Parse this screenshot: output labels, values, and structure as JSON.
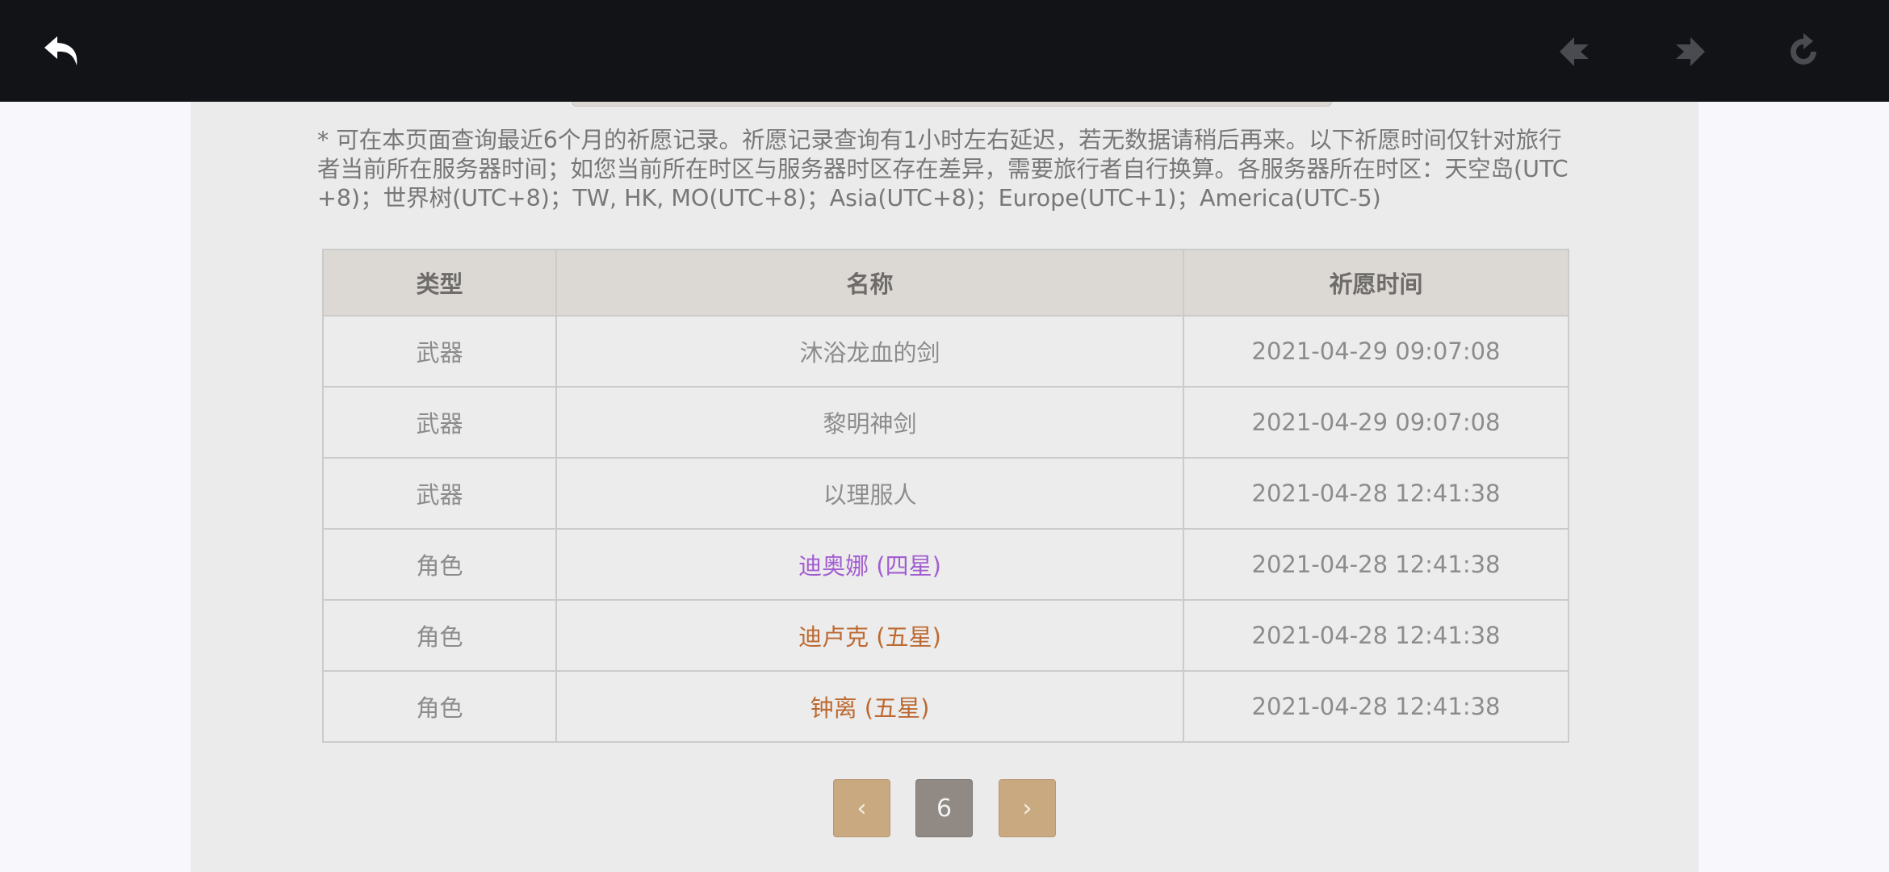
{
  "toolbar": {
    "back_icon": "back-arrow-icon",
    "prev_icon": "prev-diamond-arrow-icon",
    "next_icon": "next-diamond-arrow-icon",
    "reload_icon": "reload-icon",
    "background": "#121317"
  },
  "notice": "* 可在本页面查询最近6个月的祈愿记录。祈愿记录查询有1小时左右延迟，若无数据请稍后再来。以下祈愿时间仅针对旅行者当前所在服务器时间；如您当前所在时区与服务器时区存在差异，需要旅行者自行换算。各服务器所在时区：天空岛(UTC+8)；世界树(UTC+8)；TW, HK, MO(UTC+8)；Asia(UTC+8)；Europe(UTC+1)；America(UTC-5)",
  "table": {
    "headers": [
      "类型",
      "名称",
      "祈愿时间"
    ],
    "rows": [
      {
        "type": "武器",
        "name": "沐浴龙血的剑",
        "time": "2021-04-29 09:07:08",
        "rarity": "3"
      },
      {
        "type": "武器",
        "name": "黎明神剑",
        "time": "2021-04-29 09:07:08",
        "rarity": "3"
      },
      {
        "type": "武器",
        "name": "以理服人",
        "time": "2021-04-28 12:41:38",
        "rarity": "3"
      },
      {
        "type": "角色",
        "name": "迪奥娜 (四星)",
        "time": "2021-04-28 12:41:38",
        "rarity": "4"
      },
      {
        "type": "角色",
        "name": "迪卢克 (五星)",
        "time": "2021-04-28 12:41:38",
        "rarity": "5"
      },
      {
        "type": "角色",
        "name": "钟离 (五星)",
        "time": "2021-04-28 12:41:38",
        "rarity": "5"
      }
    ]
  },
  "colors": {
    "rarity_3": "#8c8c8c",
    "rarity_4": "#a25ed0",
    "rarity_5": "#bd6a32"
  },
  "pagination": {
    "prev_label": "‹",
    "current_page": "6",
    "next_label": "›"
  }
}
